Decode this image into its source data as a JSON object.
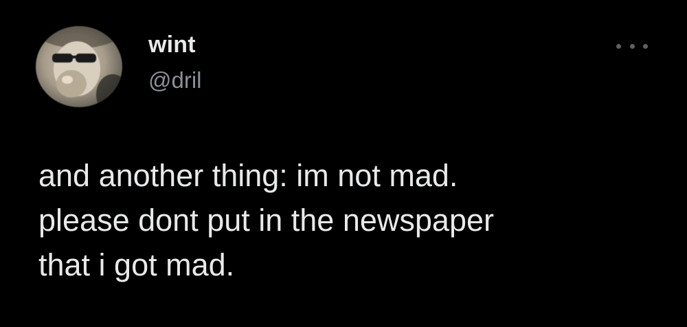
{
  "user": {
    "display_name": "wint",
    "handle": "@dril",
    "avatar_icon": "profile-photo"
  },
  "menu": {
    "icon": "more-horizontal-icon"
  },
  "tweet": {
    "lines": [
      "and another thing: im not mad.",
      "please dont put in the newspaper",
      "that i got mad."
    ]
  },
  "colors": {
    "background": "#000000",
    "primary_text": "#e7e9ea",
    "secondary_text": "#8b9096"
  }
}
